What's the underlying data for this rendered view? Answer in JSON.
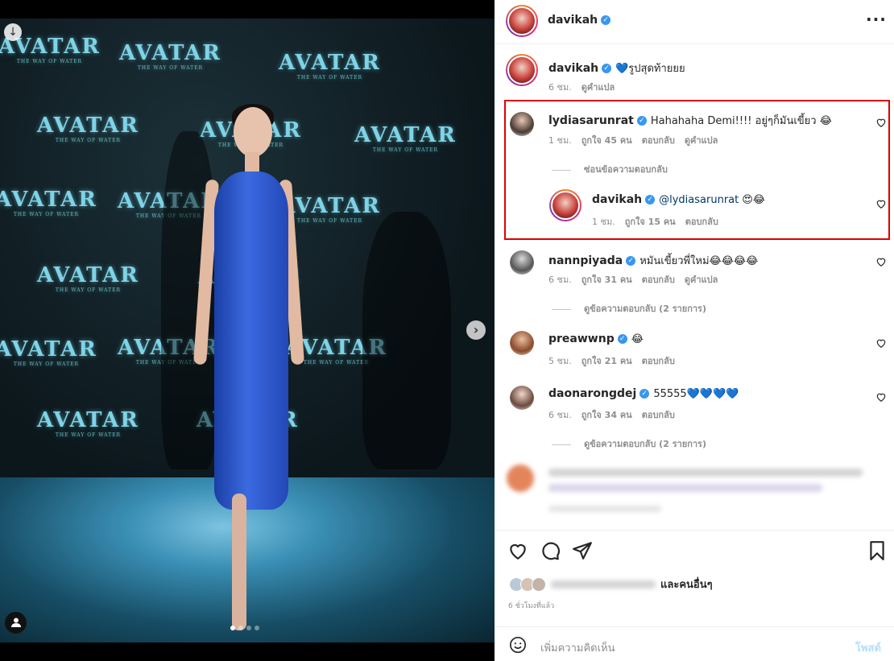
{
  "media": {
    "logo_text": "AVATAR",
    "logo_sub": "THE WAY OF WATER",
    "dots_count": 4,
    "active_dot": 0
  },
  "post": {
    "author": "davikah",
    "caption": "💙รูปสุดท้ายยย",
    "caption_time": "6 ชม.",
    "caption_translate": "ดูคำแปล"
  },
  "comments": [
    {
      "user": "lydiasarunrat",
      "verified": true,
      "text": "Hahahaha Demi!!!! อยู่ๆก็มันเขี้ยว 😂",
      "time": "1 ชม.",
      "likes": "ถูกใจ 45 คน",
      "reply": "ตอบกลับ",
      "translate": "ดูคำแปล",
      "hide_replies": "ซ่อนข้อความตอบกลับ",
      "reply_item": {
        "user": "davikah",
        "mention": "@lydiasarunrat",
        "text": "😍😂",
        "time": "1 ชม.",
        "likes": "ถูกใจ 15 คน",
        "reply": "ตอบกลับ"
      }
    },
    {
      "user": "nannpiyada",
      "verified": true,
      "text": "หมันเขี้ยวพี่ใหม่😂😂😂😂",
      "time": "6 ชม.",
      "likes": "ถูกใจ 31 คน",
      "reply": "ตอบกลับ",
      "translate": "ดูคำแปล",
      "view_replies": "ดูข้อความตอบกลับ (2 รายการ)"
    },
    {
      "user": "preawwnp",
      "verified": true,
      "text": "😂",
      "time": "5 ชม.",
      "likes": "ถูกใจ 21 คน",
      "reply": "ตอบกลับ"
    },
    {
      "user": "daonarongdej",
      "verified": true,
      "text": "55555💙💙💙💙",
      "time": "6 ชม.",
      "likes": "ถูกใจ 34 คน",
      "reply": "ตอบกลับ",
      "view_replies": "ดูข้อความตอบกลับ (2 รายการ)"
    }
  ],
  "footer": {
    "likes_suffix": "และคนอื่นๆ",
    "time_ago": "6 ชั่วโมงที่แล้ว",
    "add_comment_placeholder": "เพิ่มความคิดเห็น",
    "post_label": "โพสต์"
  },
  "colors": {
    "highlight_border": "#e00000",
    "verified": "#3897f0",
    "post_disabled": "#b2dffc"
  }
}
